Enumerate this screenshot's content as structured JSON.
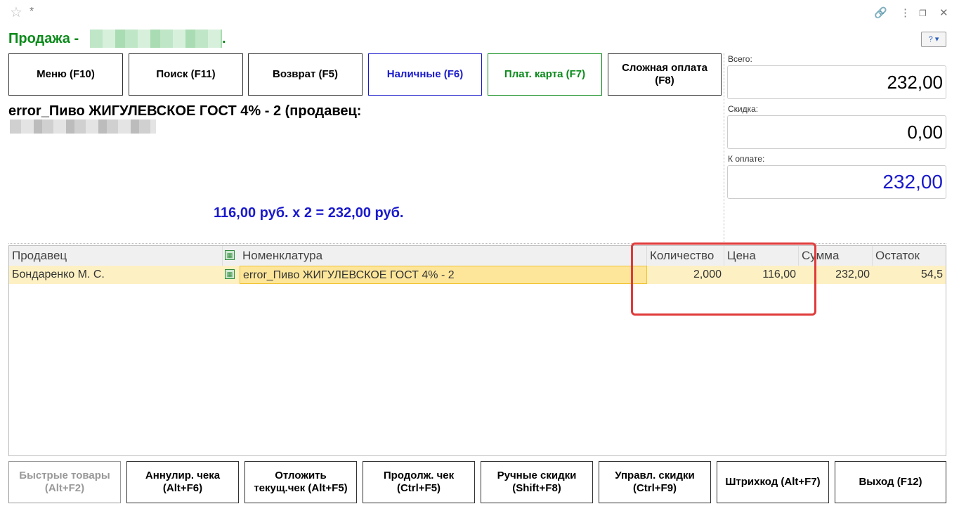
{
  "titlebar": {
    "star_icon": "star-icon",
    "modified_marker": "*",
    "icons": [
      "link-icon",
      "more-icon",
      "restore-icon",
      "close-icon"
    ]
  },
  "title": "Продажа -",
  "title_suffix": ".",
  "help_button": "?",
  "top_buttons": [
    {
      "label": "Меню (F10)"
    },
    {
      "label": "Поиск (F11)"
    },
    {
      "label": "Возврат (F5)"
    },
    {
      "label": "Наличные (F6)",
      "color": "#1a1acc"
    },
    {
      "label": "Плат. карта (F7)",
      "color": "#0a8a1a"
    },
    {
      "label": "Сложная оплата (F8)"
    }
  ],
  "product_description": "error_Пиво ЖИГУЛЕВСКОЕ ГОСТ 4% - 2 (продавец:",
  "calculation": "116,00 руб. х 2  = 232,00 руб.",
  "totals": {
    "total_label": "Всего:",
    "total_value": "232,00",
    "discount_label": "Скидка:",
    "discount_value": "0,00",
    "to_pay_label": "К оплате:",
    "to_pay_value": "232,00",
    "to_pay_color": "#1a1acc"
  },
  "table": {
    "columns": [
      "Продавец",
      "Номенклатура",
      "Количество",
      "Цена",
      "Сумма",
      "Остаток"
    ],
    "rows": [
      {
        "seller": "Бондаренко М. С.",
        "item": "error_Пиво ЖИГУЛЕВСКОЕ ГОСТ 4% - 2",
        "quantity": "2,000",
        "price": "116,00",
        "sum": "232,00",
        "remainder": "54,5"
      }
    ]
  },
  "bottom_buttons": [
    {
      "label": "Быстрые товары (Alt+F2)",
      "disabled": true
    },
    {
      "label": "Аннулир. чека (Alt+F6)"
    },
    {
      "label": "Отложить текущ.чек (Alt+F5)"
    },
    {
      "label": "Продолж. чек (Ctrl+F5)"
    },
    {
      "label": "Ручные скидки (Shift+F8)"
    },
    {
      "label": "Управл. скидки (Ctrl+F9)"
    },
    {
      "label": "Штрихкод (Alt+F7)"
    },
    {
      "label": "Выход (F12)"
    }
  ],
  "highlight_color": "#e03a3a"
}
